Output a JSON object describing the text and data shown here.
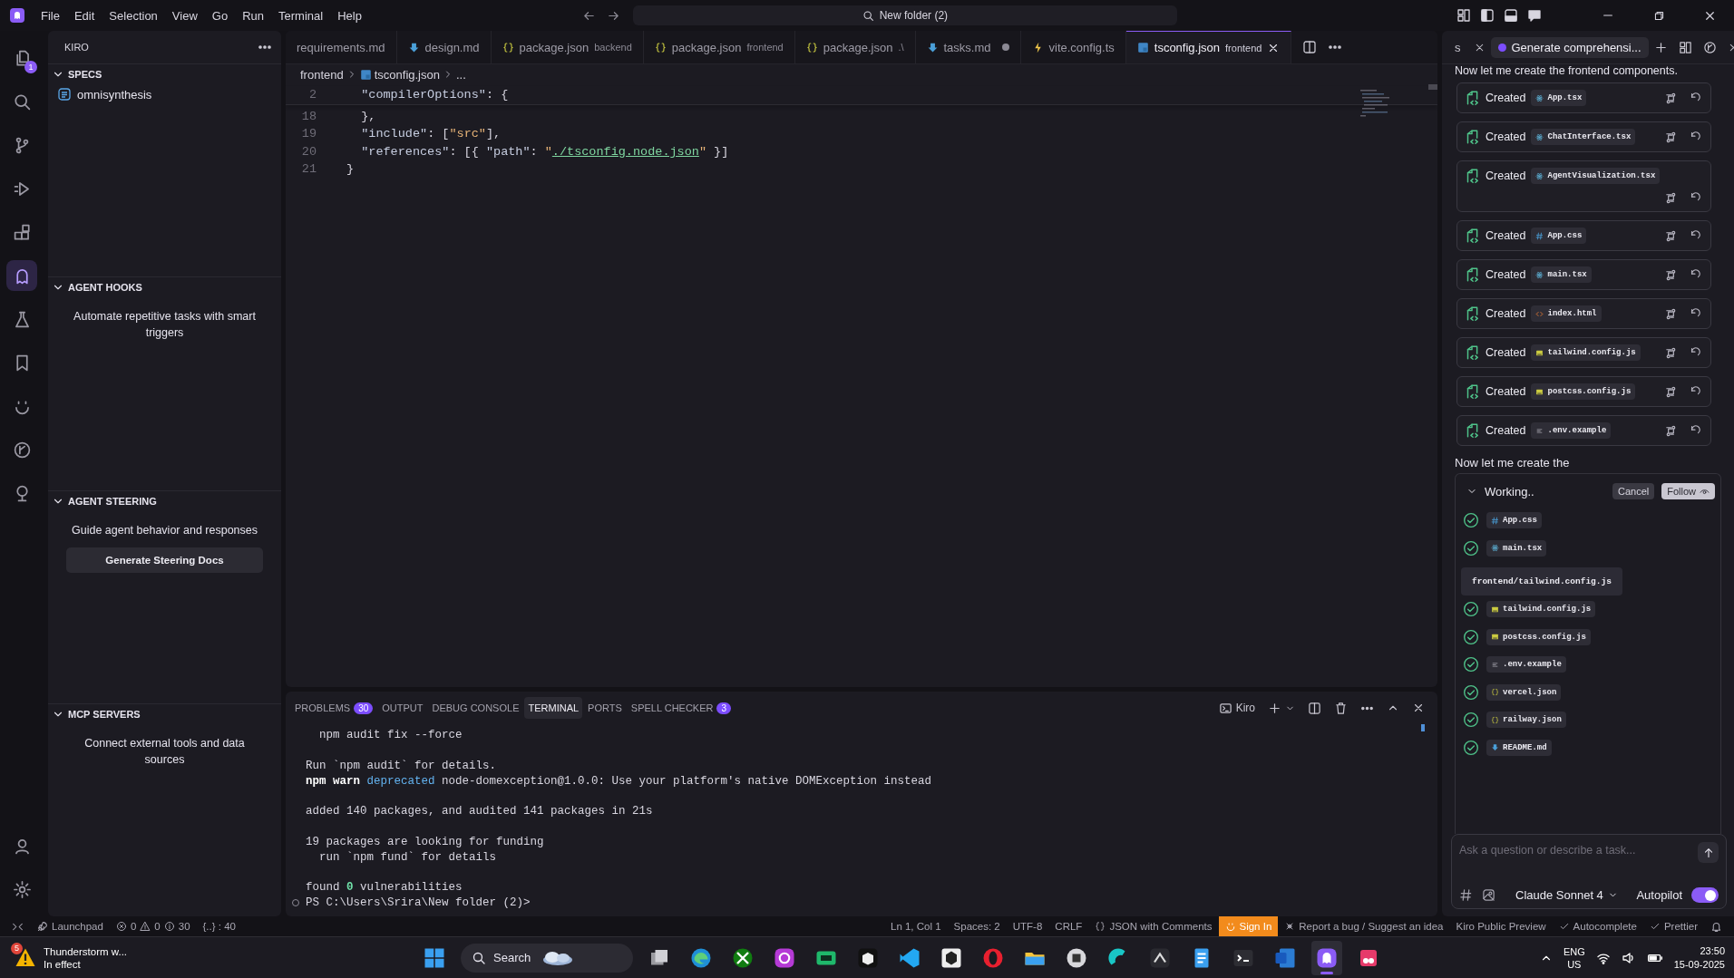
{
  "title_bar": {
    "menu": [
      "File",
      "Edit",
      "Selection",
      "View",
      "Go",
      "Run",
      "Terminal",
      "Help"
    ],
    "command_center": "New folder (2)"
  },
  "activity_bar": {
    "items": [
      {
        "kind": "explorer",
        "badge": "1",
        "selected": false
      },
      {
        "kind": "search",
        "selected": false
      },
      {
        "kind": "source-control",
        "selected": false
      },
      {
        "kind": "run",
        "selected": false
      },
      {
        "kind": "extensions",
        "selected": false
      },
      {
        "kind": "kiro",
        "selected": true
      },
      {
        "kind": "flask",
        "selected": false
      },
      {
        "kind": "bookmark",
        "selected": false
      },
      {
        "kind": "smile",
        "selected": false
      },
      {
        "kind": "timeline",
        "selected": false
      },
      {
        "kind": "tree",
        "selected": false
      }
    ],
    "bottom": [
      {
        "kind": "account"
      },
      {
        "kind": "settings"
      }
    ]
  },
  "sidebar": {
    "title": "KIRO",
    "sections": [
      {
        "title": "SPECS",
        "expanded": true,
        "items": [
          "omnisynthesis"
        ]
      },
      {
        "title": "AGENT HOOKS",
        "expanded": true,
        "description": "Automate repetitive tasks with smart triggers"
      },
      {
        "title": "AGENT STEERING",
        "expanded": true,
        "description": "Guide agent behavior and responses",
        "button": "Generate Steering Docs"
      },
      {
        "title": "MCP SERVERS",
        "expanded": true,
        "description": "Connect external tools and data sources"
      }
    ]
  },
  "editor": {
    "tabs": [
      {
        "label": "requirements.md",
        "kind": "plain",
        "selected": false,
        "modified": false
      },
      {
        "label": "design.md",
        "kind": "markdown",
        "selected": false,
        "modified": false
      },
      {
        "label": "package.json",
        "detail": "backend",
        "kind": "json",
        "selected": false,
        "modified": false
      },
      {
        "label": "package.json",
        "detail": "frontend",
        "kind": "json",
        "selected": false,
        "modified": false
      },
      {
        "label": "package.json",
        "detail": ".\\",
        "kind": "json",
        "selected": false,
        "modified": false
      },
      {
        "label": "tasks.md",
        "kind": "markdown",
        "selected": false,
        "modified": true
      },
      {
        "label": "vite.config.ts",
        "kind": "vite",
        "selected": false,
        "modified": false
      },
      {
        "label": "tsconfig.json",
        "detail": "frontend",
        "kind": "typescript",
        "selected": true,
        "modified": false
      }
    ],
    "breadcrumb": [
      "frontend",
      "tsconfig.json",
      "..."
    ],
    "lines": [
      {
        "number": "2",
        "tokens": [
          {
            "text": "  \"compilerOptions\"",
            "kind": "key"
          },
          {
            "text": ": {",
            "kind": "punct"
          }
        ]
      },
      {
        "number": "18",
        "tokens": [
          {
            "text": "  },",
            "kind": "punct"
          }
        ]
      },
      {
        "number": "19",
        "tokens": [
          {
            "text": "  \"include\"",
            "kind": "key"
          },
          {
            "text": ": [",
            "kind": "punct"
          },
          {
            "text": "\"src\"",
            "kind": "string"
          },
          {
            "text": "],",
            "kind": "punct"
          }
        ]
      },
      {
        "number": "20",
        "tokens": [
          {
            "text": "  \"references\"",
            "kind": "key"
          },
          {
            "text": ": [{ ",
            "kind": "punct"
          },
          {
            "text": "\"path\"",
            "kind": "key"
          },
          {
            "text": ": ",
            "kind": "punct"
          },
          {
            "text": "\"",
            "kind": "string"
          },
          {
            "text": "./tsconfig.node.json",
            "kind": "link"
          },
          {
            "text": "\"",
            "kind": "string"
          },
          {
            "text": " }]",
            "kind": "punct"
          }
        ]
      },
      {
        "number": "21",
        "tokens": [
          {
            "text": "}",
            "kind": "punct"
          }
        ]
      }
    ]
  },
  "panel": {
    "tabs": [
      {
        "label": "PROBLEMS",
        "count": "30",
        "selected": false
      },
      {
        "label": "OUTPUT",
        "selected": false
      },
      {
        "label": "DEBUG CONSOLE",
        "selected": false
      },
      {
        "label": "TERMINAL",
        "selected": true
      },
      {
        "label": "PORTS",
        "selected": false
      },
      {
        "label": "SPELL CHECKER",
        "count": "3",
        "selected": false
      }
    ],
    "terminal_name": "Kiro",
    "blocks": [
      [
        {
          "kind": "output",
          "segments": [
            {
              "text": "  npm audit fix --force",
              "kind": "plain"
            }
          ]
        }
      ],
      [
        {
          "kind": "output",
          "segments": [
            {
              "text": "Run `npm audit` for details.",
              "kind": "plain"
            }
          ]
        },
        {
          "kind": "output",
          "segments": [
            {
              "text": "npm warn ",
              "kind": "bold"
            },
            {
              "text": "deprecated",
              "kind": "link"
            },
            {
              "text": " node-domexception@1.0.0: Use your platform's native DOMException instead",
              "kind": "plain"
            }
          ]
        }
      ],
      [
        {
          "kind": "output",
          "segments": [
            {
              "text": "added 140 packages, and audited 141 packages in 21s",
              "kind": "plain"
            }
          ]
        }
      ],
      [
        {
          "kind": "output",
          "segments": [
            {
              "text": "19 packages are looking for funding",
              "kind": "plain"
            }
          ]
        },
        {
          "kind": "output",
          "segments": [
            {
              "text": "  run `npm fund` for details",
              "kind": "plain"
            }
          ]
        }
      ],
      [
        {
          "kind": "output",
          "segments": [
            {
              "text": "found ",
              "kind": "plain"
            },
            {
              "text": "0",
              "kind": "number"
            },
            {
              "text": " vulnerabilities",
              "kind": "plain"
            }
          ]
        },
        {
          "kind": "prompt",
          "segments": [
            {
              "text": "PS C:\\Users\\Srira\\New folder (2)>",
              "kind": "plain"
            }
          ]
        }
      ]
    ]
  },
  "chat": {
    "tabs": [
      {
        "label": "s",
        "selected": false
      },
      {
        "label": "Generate comprehensi...",
        "selected": true
      }
    ],
    "intro": "Now let me create the frontend components.",
    "created": [
      {
        "verb": "Created",
        "file": "App.tsx",
        "kind": "react"
      },
      {
        "verb": "Created",
        "file": "ChatInterface.tsx",
        "kind": "react"
      },
      {
        "verb": "Created",
        "file": "AgentVisualization.tsx",
        "kind": "react"
      },
      {
        "verb": "Created",
        "file": "App.css",
        "kind": "css"
      },
      {
        "verb": "Created",
        "file": "main.tsx",
        "kind": "react"
      },
      {
        "verb": "Created",
        "file": "index.html",
        "kind": "html"
      },
      {
        "verb": "Created",
        "file": "tailwind.config.js",
        "kind": "js"
      },
      {
        "verb": "Created",
        "file": "postcss.config.js",
        "kind": "js"
      },
      {
        "verb": "Created",
        "file": ".env.example",
        "kind": "env"
      }
    ],
    "outro": "Now let me create the",
    "working": {
      "label": "Working..",
      "expanded": true,
      "cancel": "Cancel",
      "follow": "Follow",
      "items": [
        {
          "kind": "css",
          "file": "App.css",
          "done": true
        },
        {
          "kind": "react",
          "file": "main.tsx",
          "done": true
        },
        {
          "kind": "tooltip",
          "text": "frontend/tailwind.config.js"
        },
        {
          "kind": "js",
          "file": "tailwind.config.js",
          "done": true
        },
        {
          "kind": "js",
          "file": "postcss.config.js",
          "done": true
        },
        {
          "kind": "env",
          "file": ".env.example",
          "done": true
        },
        {
          "kind": "json",
          "file": "vercel.json",
          "done": true
        },
        {
          "kind": "json",
          "file": "railway.json",
          "done": true
        },
        {
          "kind": "markdown",
          "file": "README.md",
          "done": true
        }
      ]
    },
    "input": {
      "placeholder": "Ask a question or describe a task...",
      "model": "Claude Sonnet 4",
      "mode": "Autopilot",
      "autopilot": true
    }
  },
  "status_bar": {
    "left": [
      {
        "kind": "remote"
      },
      {
        "kind": "launchpad",
        "text": "Launchpad"
      },
      {
        "kind": "problems",
        "errors": "0",
        "warnings": "0",
        "info": "30"
      },
      {
        "kind": "text",
        "text": "{..} : 40"
      }
    ],
    "right": [
      {
        "kind": "text",
        "text": "Ln 1, Col 1"
      },
      {
        "kind": "text",
        "text": "Spaces: 2"
      },
      {
        "kind": "text",
        "text": "UTF-8"
      },
      {
        "kind": "text",
        "text": "CRLF"
      },
      {
        "kind": "language",
        "text": "JSON with Comments"
      },
      {
        "kind": "sign-in",
        "text": "Sign In"
      },
      {
        "kind": "feedback",
        "text": "Report a bug / Suggest an idea"
      },
      {
        "kind": "text",
        "text": "Kiro Public Preview"
      },
      {
        "kind": "check",
        "text": "Autocomplete"
      },
      {
        "kind": "check",
        "text": "Prettier"
      },
      {
        "kind": "bell"
      }
    ]
  },
  "taskbar": {
    "weather": {
      "badge": "5",
      "title": "Thunderstorm w...",
      "subtitle": "In effect"
    },
    "search": "Search",
    "apps": [
      {
        "kind": "start",
        "selected": false
      },
      {
        "kind": "task-view",
        "selected": false
      },
      {
        "kind": "edge",
        "selected": false
      },
      {
        "kind": "xbox",
        "selected": false
      },
      {
        "kind": "purple",
        "selected": false
      },
      {
        "kind": "green",
        "selected": false
      },
      {
        "kind": "box",
        "selected": false
      },
      {
        "kind": "vscode",
        "selected": false
      },
      {
        "kind": "unity",
        "selected": false
      },
      {
        "kind": "opera",
        "selected": false
      },
      {
        "kind": "folder",
        "selected": false
      },
      {
        "kind": "gray",
        "selected": false
      },
      {
        "kind": "cyan",
        "selected": false
      },
      {
        "kind": "dark",
        "selected": false
      },
      {
        "kind": "notepad",
        "selected": false
      },
      {
        "kind": "terminal",
        "selected": false
      },
      {
        "kind": "word",
        "selected": false
      },
      {
        "kind": "kiro",
        "selected": true
      },
      {
        "kind": "snip",
        "selected": false
      }
    ],
    "language": "ENG",
    "region": "US",
    "time": "23:50",
    "date": "15-09-2025"
  }
}
